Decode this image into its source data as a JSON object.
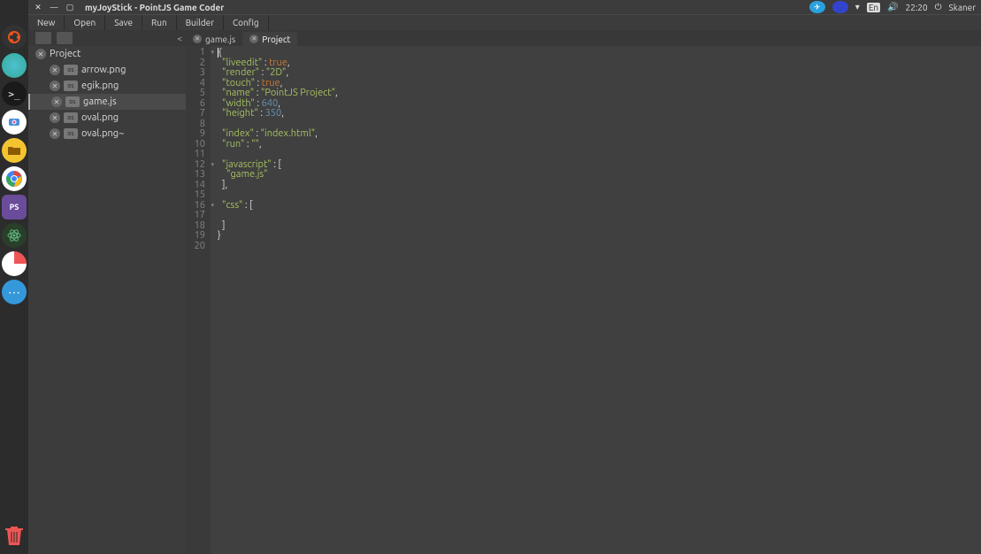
{
  "titlebar": {
    "title": "myJoyStick - PointJS Game Coder",
    "lang": "En",
    "time": "22:20",
    "user": "Skaner"
  },
  "menu": {
    "new": "New",
    "open": "Open",
    "save": "Save",
    "run": "Run",
    "builder": "Builder",
    "config": "Config"
  },
  "sidebar": {
    "project": "Project",
    "files": [
      {
        "name": "arrow.png"
      },
      {
        "name": "egik.png"
      },
      {
        "name": "game.js"
      },
      {
        "name": "oval.png"
      },
      {
        "name": "oval.png~"
      }
    ]
  },
  "tabs": [
    {
      "label": "game.js",
      "active": false
    },
    {
      "label": "Project",
      "active": true
    }
  ],
  "code_lines": [
    "1",
    "2",
    "3",
    "4",
    "5",
    "6",
    "7",
    "8",
    "9",
    "10",
    "11",
    "12",
    "13",
    "14",
    "15",
    "16",
    "17",
    "18",
    "19",
    "20"
  ],
  "code": {
    "l1_brace": "{",
    "l2_key": "\"liveedit\"",
    "l2_sep": " : ",
    "l2_val": "true",
    "l2_c": ",",
    "l3_key": "\"render\"",
    "l3_sep": " : ",
    "l3_val": "\"2D\"",
    "l3_c": ",",
    "l4_key": "\"touch\"",
    "l4_sep": " : ",
    "l4_val": "true",
    "l4_c": ",",
    "l5_key": "\"name\"",
    "l5_sep": " : ",
    "l5_val": "\"PointJS Project\"",
    "l5_c": ",",
    "l6_key": "\"width\"",
    "l6_sep": " : ",
    "l6_val": "640",
    "l6_c": ",",
    "l7_key": "\"height\"",
    "l7_sep": " : ",
    "l7_val": "350",
    "l7_c": ",",
    "l9_key": "\"index\"",
    "l9_sep": " : ",
    "l9_val": "\"index.html\"",
    "l9_c": ",",
    "l10_key": "\"run\"",
    "l10_sep": " : ",
    "l10_val": "\"\"",
    "l10_c": ",",
    "l12_key": "\"javascript\"",
    "l12_sep": " : ",
    "l12_val": "[",
    "l13_val": "\"game.js\"",
    "l14_val": "],",
    "l16_key": "\"css\"",
    "l16_sep": " : ",
    "l16_val": "[",
    "l18_val": "]",
    "l19_val": "}"
  }
}
